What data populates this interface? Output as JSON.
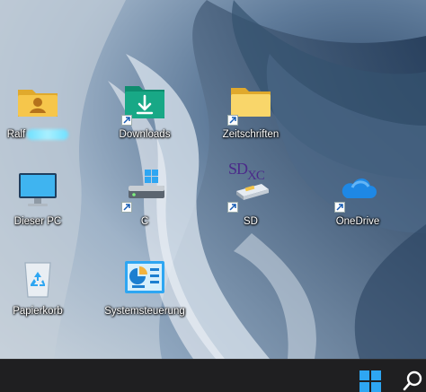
{
  "desktop": {
    "icons": [
      {
        "label": "Ralf",
        "icon": "user-folder-icon",
        "shortcut": false
      },
      {
        "label": "Downloads",
        "icon": "downloads-folder-icon",
        "shortcut": true
      },
      {
        "label": "Zeitschriften",
        "icon": "folder-icon",
        "shortcut": true
      },
      {
        "label": "Dieser PC",
        "icon": "monitor-icon",
        "shortcut": false
      },
      {
        "label": "C",
        "icon": "drive-icon",
        "shortcut": true
      },
      {
        "label": "SD",
        "icon": "sd-card-icon",
        "shortcut": true
      },
      {
        "label": "OneDrive",
        "icon": "onedrive-cloud-icon",
        "shortcut": true
      },
      {
        "label": "Papierkorb",
        "icon": "recycle-bin-icon",
        "shortcut": false
      },
      {
        "label": "Systemsteuerung",
        "icon": "control-panel-icon",
        "shortcut": false
      }
    ],
    "sd_logo": {
      "main": "SD",
      "sub": "XC"
    }
  },
  "taskbar": {
    "start_icon": "windows-logo-icon",
    "search_icon": "search-icon"
  },
  "colors": {
    "taskbar": "#1f1f21",
    "windows_blue": "#2ea6f2",
    "folder_yellow": "#f6c64b"
  }
}
